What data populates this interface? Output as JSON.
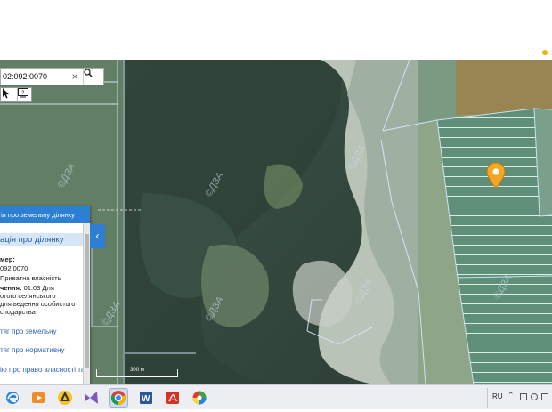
{
  "browser": {
    "title_dots": [
      "·",
      "·",
      "·",
      "·",
      "·",
      "·",
      "·"
    ]
  },
  "map": {
    "search": {
      "value": "02:092:0070",
      "clear_icon": "close-icon",
      "button_icon": "search-icon"
    },
    "tools": [
      "cursor-icon",
      "info-icon"
    ],
    "watermark": "©ДЗА",
    "scale_label": "300 м",
    "marker_color": "#f5a623"
  },
  "panel": {
    "header": "ія про земельну ділянку",
    "section": "ація про ділянку",
    "number_label": "мер:",
    "number_value": "092:0070",
    "ownership": "Приватна власність",
    "purpose_label": "чення:",
    "purpose_value": "01.03 Для",
    "purpose_line2": "отого селянського",
    "purpose_line3": "для ведення особистого",
    "purpose_line4": "сподарства",
    "links": [
      "тяг про земельну",
      "тяг про нормативну",
      "ію про право власності та"
    ]
  },
  "taskbar": {
    "apps": [
      "edge-icon",
      "media-player-icon",
      "avast-icon",
      "visual-studio-icon",
      "chrome-icon",
      "word-icon",
      "acrobat-icon",
      "picasa-icon"
    ],
    "active_app": "chrome-icon",
    "tray": {
      "language": "RU"
    }
  },
  "colors": {
    "panel_blue": "#2d7fd4",
    "link_blue": "#2b63b8",
    "marker": "#f5a623"
  }
}
